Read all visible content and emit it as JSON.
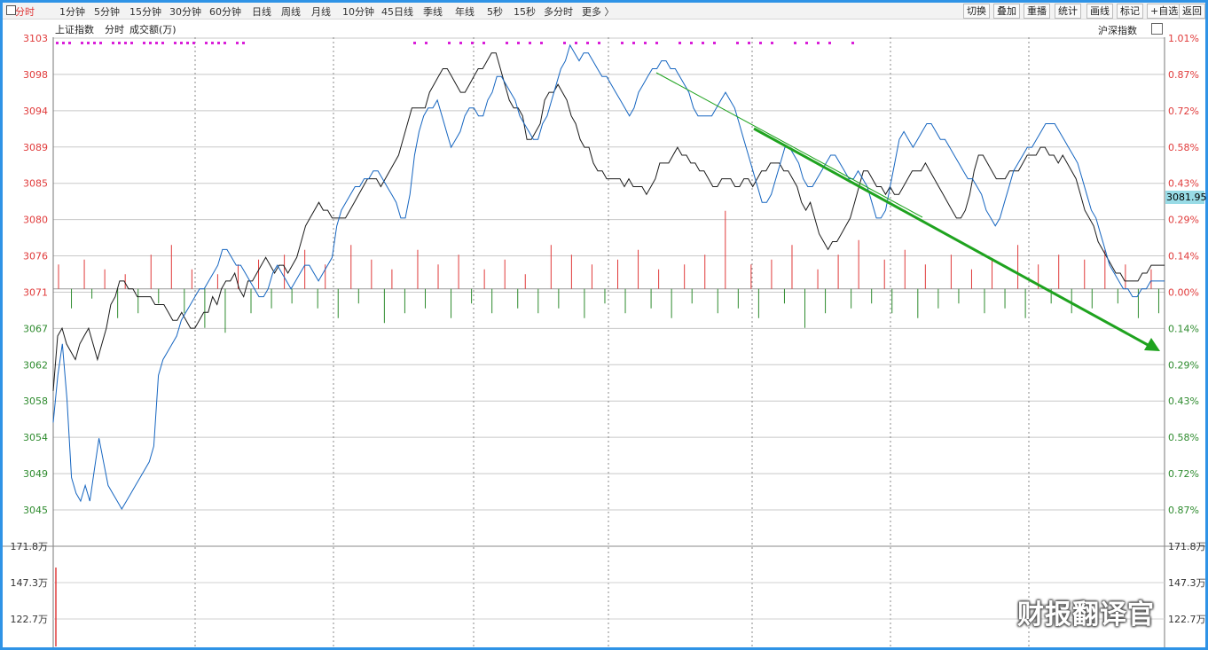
{
  "toolbar": {
    "tabs": [
      "分时",
      "1分钟",
      "5分钟",
      "15分钟",
      "30分钟",
      "60分钟",
      "日线",
      "周线",
      "月线",
      "10分钟",
      "45日线",
      "季线",
      "年线",
      "5秒",
      "15秒",
      "多分时",
      "更多 〉"
    ],
    "active_tab": "分时",
    "right_buttons": [
      "切换",
      "叠加",
      "重播",
      "统计",
      "画线",
      "标记",
      "+自选",
      "返回"
    ]
  },
  "header": {
    "left_labels": [
      "上证指数",
      "分时",
      "成交额(万)"
    ],
    "right_label": "沪深指数"
  },
  "colors": {
    "up": "#e03a3a",
    "down": "#2e8b2e",
    "index_line": "#1a1a1a",
    "overlay_line": "#1565c0",
    "marker": "#d91fd9",
    "arrow": "#1fa31f",
    "frame": "#2f93e6"
  },
  "watermark": "财报翻译官",
  "chart_data": {
    "type": "line",
    "y_left_ticks": [
      "3103",
      "3098",
      "3094",
      "3089",
      "3085",
      "3080",
      "3076",
      "3071",
      "3067",
      "3062",
      "3058",
      "3054",
      "3049",
      "3045"
    ],
    "y_right_ticks": [
      "1.01%",
      "0.87%",
      "0.72%",
      "0.58%",
      "0.43%",
      "0.29%",
      "0.14%",
      "0.00%",
      "0.14%",
      "0.29%",
      "0.43%",
      "0.58%",
      "0.72%",
      "0.87%"
    ],
    "ylim": [
      3043,
      3103
    ],
    "reference": 3071,
    "volume_ticks": [
      "171.8万",
      "147.3万",
      "122.7万"
    ],
    "current_value_tag": "3081.95",
    "series": [
      {
        "name": "上证指数",
        "values": [
          3058,
          3065,
          3066,
          3064,
          3063,
          3062,
          3064,
          3065,
          3066,
          3064,
          3062,
          3064,
          3066,
          3069,
          3070,
          3072,
          3072,
          3071,
          3071,
          3070,
          3070,
          3070,
          3070,
          3069,
          3069,
          3069,
          3068,
          3067,
          3067,
          3068,
          3067,
          3066,
          3066,
          3067,
          3068,
          3068,
          3070,
          3069,
          3071,
          3072,
          3072,
          3073,
          3071,
          3070,
          3072,
          3072,
          3073,
          3074,
          3075,
          3074,
          3073,
          3074,
          3074,
          3073,
          3074,
          3075,
          3077,
          3079,
          3080,
          3081,
          3082,
          3081,
          3081,
          3080,
          3080,
          3080,
          3080,
          3081,
          3082,
          3083,
          3084,
          3085,
          3085,
          3085,
          3084,
          3085,
          3086,
          3087,
          3088,
          3090,
          3092,
          3094,
          3094,
          3094,
          3094,
          3096,
          3097,
          3098,
          3099,
          3099,
          3098,
          3097,
          3096,
          3096,
          3097,
          3098,
          3099,
          3099,
          3100,
          3101,
          3101,
          3099,
          3097,
          3095,
          3094,
          3094,
          3093,
          3090,
          3090,
          3091,
          3092,
          3095,
          3096,
          3096,
          3097,
          3096,
          3095,
          3093,
          3092,
          3090,
          3089,
          3089,
          3087,
          3086,
          3086,
          3085,
          3085,
          3085,
          3085,
          3084,
          3085,
          3084,
          3084,
          3084,
          3083,
          3084,
          3085,
          3087,
          3087,
          3087,
          3088,
          3089,
          3088,
          3088,
          3087,
          3087,
          3086,
          3086,
          3085,
          3084,
          3084,
          3085,
          3085,
          3085,
          3084,
          3084,
          3085,
          3085,
          3084,
          3085,
          3086,
          3086,
          3087,
          3087,
          3087,
          3086,
          3086,
          3085,
          3084,
          3082,
          3081,
          3082,
          3080,
          3078,
          3077,
          3076,
          3077,
          3077,
          3078,
          3079,
          3080,
          3082,
          3084,
          3086,
          3086,
          3085,
          3084,
          3084,
          3083,
          3084,
          3083,
          3083,
          3084,
          3085,
          3086,
          3086,
          3086,
          3087,
          3086,
          3085,
          3084,
          3083,
          3082,
          3081,
          3080,
          3080,
          3081,
          3083,
          3086,
          3088,
          3088,
          3087,
          3086,
          3085,
          3085,
          3085,
          3086,
          3086,
          3086,
          3087,
          3088,
          3088,
          3088,
          3089,
          3089,
          3088,
          3088,
          3087,
          3088,
          3087,
          3086,
          3085,
          3083,
          3081,
          3080,
          3079,
          3077,
          3076,
          3075,
          3074,
          3073,
          3073,
          3072,
          3072,
          3072,
          3072,
          3073,
          3073,
          3074,
          3074,
          3074,
          3074
        ]
      },
      {
        "name": "沪深指数",
        "values": [
          3054,
          3060,
          3064,
          3057,
          3047,
          3045,
          3044,
          3046,
          3044,
          3048,
          3052,
          3049,
          3046,
          3045,
          3044,
          3043,
          3044,
          3045,
          3046,
          3047,
          3048,
          3049,
          3051,
          3060,
          3062,
          3063,
          3064,
          3065,
          3067,
          3068,
          3069,
          3070,
          3071,
          3071,
          3072,
          3073,
          3074,
          3076,
          3076,
          3075,
          3074,
          3074,
          3073,
          3072,
          3071,
          3070,
          3070,
          3071,
          3073,
          3074,
          3073,
          3072,
          3071,
          3072,
          3073,
          3074,
          3074,
          3073,
          3072,
          3073,
          3074,
          3075,
          3079,
          3081,
          3082,
          3083,
          3084,
          3084,
          3085,
          3085,
          3086,
          3086,
          3085,
          3084,
          3083,
          3082,
          3080,
          3080,
          3083,
          3088,
          3091,
          3093,
          3094,
          3094,
          3095,
          3093,
          3091,
          3089,
          3090,
          3091,
          3093,
          3094,
          3094,
          3093,
          3093,
          3095,
          3096,
          3098,
          3098,
          3097,
          3096,
          3095,
          3093,
          3092,
          3091,
          3090,
          3090,
          3092,
          3093,
          3095,
          3097,
          3099,
          3100,
          3102,
          3101,
          3100,
          3101,
          3101,
          3100,
          3099,
          3098,
          3098,
          3097,
          3096,
          3095,
          3094,
          3093,
          3094,
          3096,
          3097,
          3098,
          3099,
          3099,
          3100,
          3100,
          3099,
          3099,
          3098,
          3097,
          3096,
          3094,
          3093,
          3093,
          3093,
          3093,
          3094,
          3095,
          3096,
          3095,
          3094,
          3092,
          3090,
          3088,
          3086,
          3084,
          3082,
          3082,
          3083,
          3085,
          3087,
          3089,
          3089,
          3088,
          3087,
          3085,
          3084,
          3084,
          3085,
          3086,
          3087,
          3088,
          3088,
          3087,
          3086,
          3085,
          3085,
          3086,
          3085,
          3084,
          3082,
          3080,
          3080,
          3081,
          3084,
          3087,
          3090,
          3091,
          3090,
          3089,
          3090,
          3091,
          3092,
          3092,
          3091,
          3090,
          3090,
          3089,
          3088,
          3087,
          3086,
          3085,
          3085,
          3084,
          3083,
          3081,
          3080,
          3079,
          3080,
          3082,
          3084,
          3086,
          3087,
          3088,
          3089,
          3089,
          3090,
          3091,
          3092,
          3092,
          3092,
          3091,
          3090,
          3089,
          3088,
          3087,
          3085,
          3083,
          3081,
          3080,
          3078,
          3076,
          3074,
          3073,
          3072,
          3071,
          3071,
          3070,
          3070,
          3071,
          3071,
          3072,
          3072,
          3072,
          3072
        ]
      }
    ],
    "volume_bars": [
      0.5,
      -0.4,
      0.6,
      -0.2,
      0.4,
      -0.6,
      0.3,
      -0.5,
      0.7,
      -0.3,
      0.9,
      -0.5,
      0.4,
      -0.8,
      0.3,
      -0.9,
      0.5,
      -0.5,
      0.6,
      -0.4,
      0.7,
      -0.3,
      0.8,
      -0.4,
      0.5,
      -0.6,
      0.9,
      -0.3,
      0.6,
      -0.7,
      0.4,
      -0.5,
      0.8,
      -0.4,
      0.5,
      -0.6,
      0.7,
      -0.3,
      0.4,
      -0.5,
      0.6,
      -0.4,
      0.3,
      -0.5,
      0.9,
      -0.4,
      0.7,
      -0.6,
      0.5,
      -0.3,
      0.6,
      -0.5,
      0.8,
      -0.4,
      0.4,
      -0.6,
      0.5,
      -0.3,
      0.7,
      -0.5,
      1.6,
      -0.4,
      0.5,
      -0.6,
      0.6,
      -0.3,
      0.9,
      -0.8,
      0.4,
      -0.5,
      0.7,
      -0.4,
      1.0,
      -0.3,
      0.6,
      -0.5,
      0.8,
      -0.6,
      0.5,
      -0.4,
      0.7,
      -0.3,
      0.4,
      -0.5,
      0.6,
      -0.4,
      0.9,
      -0.6,
      0.5,
      -0.3,
      0.7,
      -0.5,
      0.6,
      -0.4,
      0.8,
      -0.3,
      0.5,
      -0.6,
      0.4,
      -0.5
    ]
  }
}
